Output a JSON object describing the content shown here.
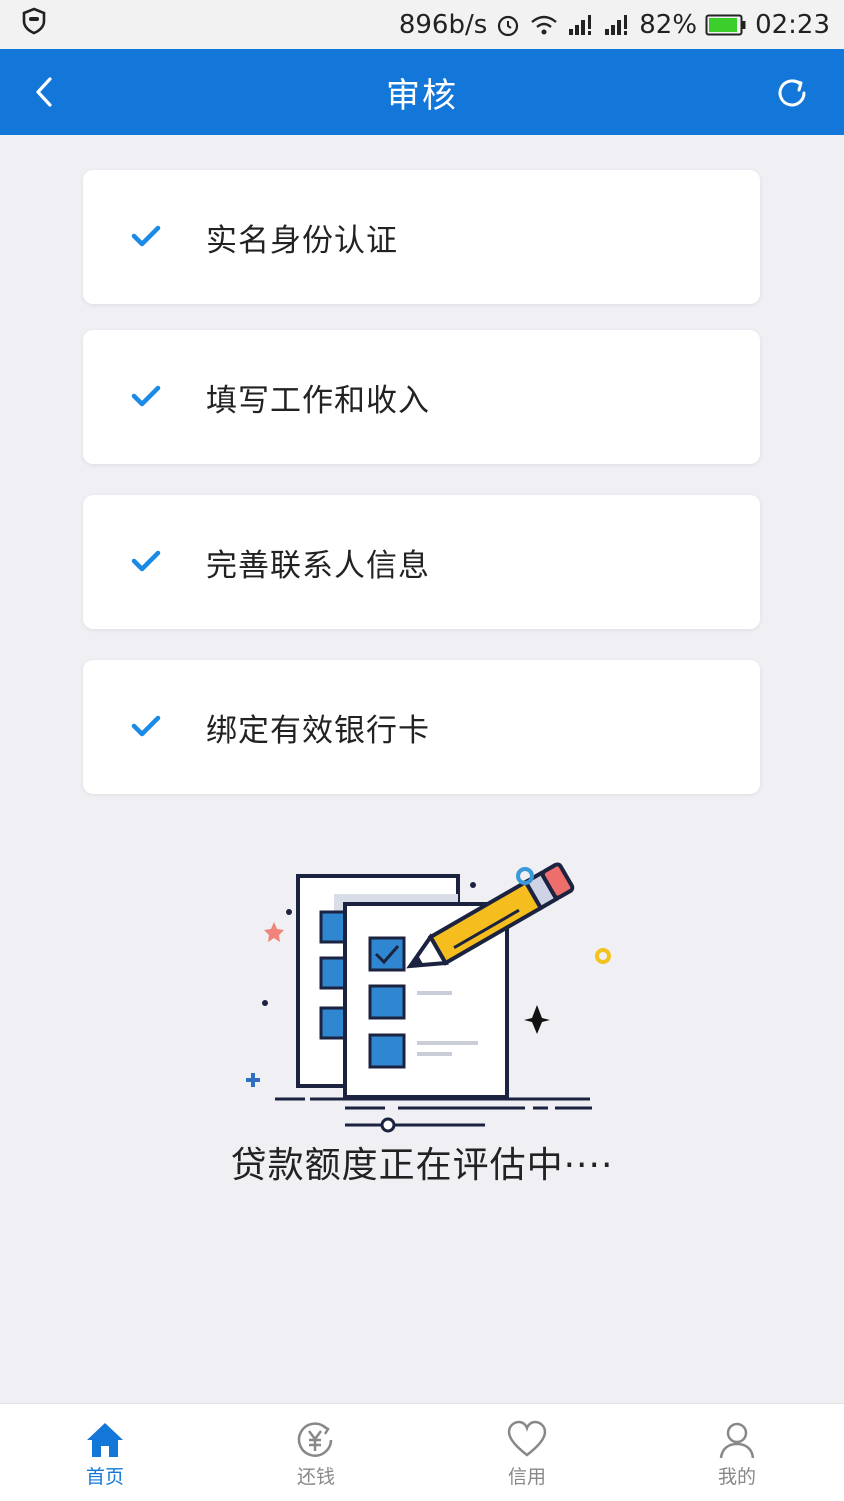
{
  "status_bar": {
    "speed": "896b/s",
    "battery": "82%",
    "time": "02:23",
    "icons": [
      "shield-icon",
      "alarm-icon",
      "wifi-icon",
      "signal-icon",
      "signal-icon",
      "battery-icon"
    ]
  },
  "header": {
    "title": "审核",
    "back_icon": "chevron-left-icon",
    "refresh_icon": "refresh-icon",
    "background": "#1377d9"
  },
  "steps": [
    {
      "label": "实名身份认证",
      "status": "completed"
    },
    {
      "label": "填写工作和收入",
      "status": "completed"
    },
    {
      "label": "完善联系人信息",
      "status": "completed"
    },
    {
      "label": "绑定有效银行卡",
      "status": "completed"
    }
  ],
  "evaluation": {
    "message": "贷款额度正在评估中····",
    "illustration": "checklist-with-pencil"
  },
  "bottom_nav": {
    "items": [
      {
        "label": "首页",
        "icon": "home-icon",
        "active": true
      },
      {
        "label": "还钱",
        "icon": "yuan-icon",
        "active": false
      },
      {
        "label": "信用",
        "icon": "heart-icon",
        "active": false
      },
      {
        "label": "我的",
        "icon": "user-icon",
        "active": false
      }
    ]
  },
  "colors": {
    "accent": "#1377d9",
    "check": "#1a8ae5",
    "background": "#efeff4"
  }
}
